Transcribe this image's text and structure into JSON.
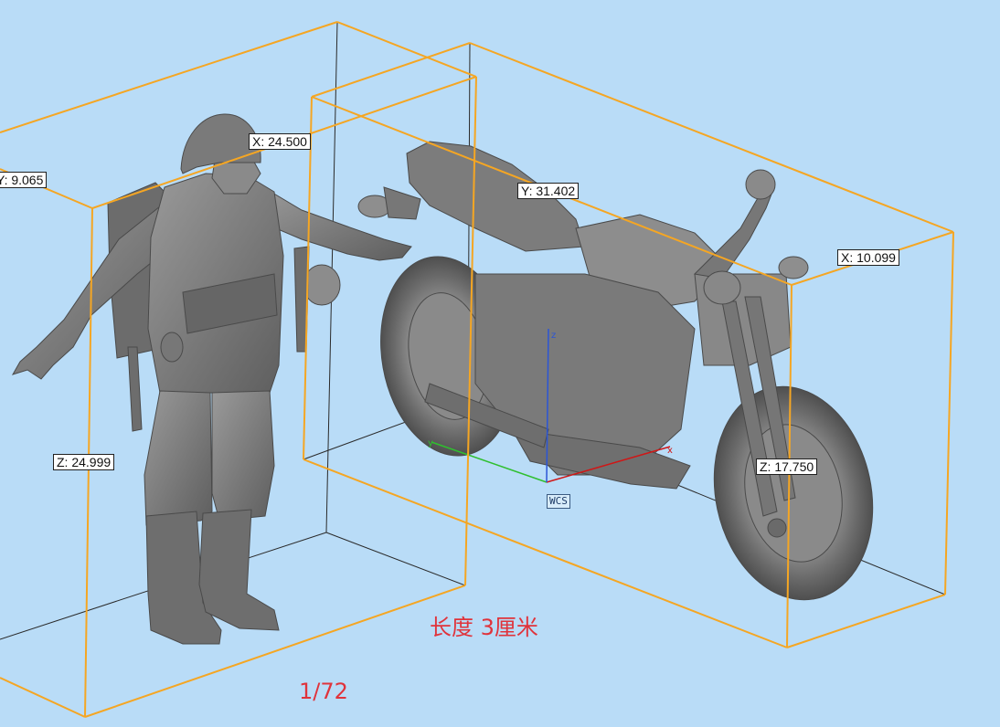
{
  "dimensions": {
    "figure": {
      "x": "X: 24.500",
      "y": "Y: 9.065",
      "z": "Z: 24.999"
    },
    "motorcycle": {
      "x": "X: 10.099",
      "y": "Y: 31.402",
      "z": "Z: 17.750"
    }
  },
  "coordinate_system": {
    "label": "WCS"
  },
  "captions": {
    "length": "长度 3厘米",
    "scale": "1/72"
  },
  "colors": {
    "background": "#b9dcf7",
    "bounding_box": "#f5a623",
    "model": "#7d7d7d",
    "caption": "#e0333b",
    "axis_x": "#d01616",
    "axis_y": "#2fbf2f",
    "axis_z": "#2b55d6"
  }
}
